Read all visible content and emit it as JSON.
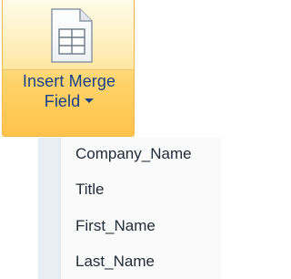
{
  "ribbon_button": {
    "label_line1": "Insert Merge",
    "label_line2": "Field",
    "icon": "merge-field-document-icon",
    "dropdown_icon": "chevron-down-icon",
    "state": "hover-highlight"
  },
  "menu": {
    "items": [
      {
        "label": "Title"
      },
      {
        "label": "First_Name"
      },
      {
        "label": "Last_Name"
      },
      {
        "label": "Company_Name"
      }
    ]
  },
  "colors": {
    "label_text": "#15428b",
    "menu_text": "#222c38",
    "highlight_border": "#f2b649",
    "highlight_fill": "#ffd36b",
    "menu_gutter": "#e9eef3"
  }
}
